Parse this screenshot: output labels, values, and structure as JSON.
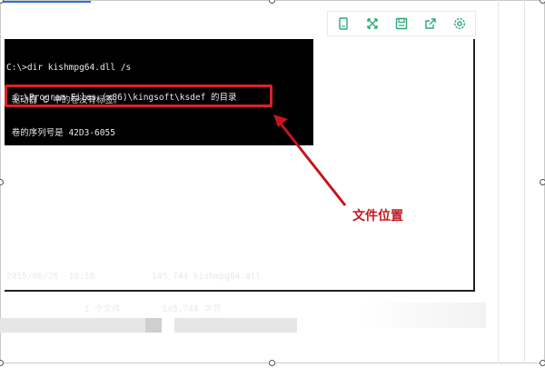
{
  "toolbar": {
    "buttons": [
      {
        "name": "copy-icon"
      },
      {
        "name": "fullscreen-icon"
      },
      {
        "name": "save-icon"
      },
      {
        "name": "share-icon"
      },
      {
        "name": "settings-icon"
      }
    ]
  },
  "terminal": {
    "lines": [
      "C:\\>dir kishmpg64.dll /s",
      " 驱动器 C 中的卷没有标签。",
      " 卷的序列号是 42D3-6055",
      "",
      "",
      "",
      "2015/06/26  10:10           145,744 kishmpg64.dll",
      "               1 个文件        145,744 字节"
    ],
    "highlighted_path": " C:\\Program Files (x86)\\kingsoft\\ksdef 的目录"
  },
  "annotation": {
    "text": "文件位置",
    "color": "#c4161c"
  },
  "colors": {
    "highlight_border": "#d9222a",
    "terminal_bg": "#000000",
    "accent_blue": "#2f6fd6"
  }
}
